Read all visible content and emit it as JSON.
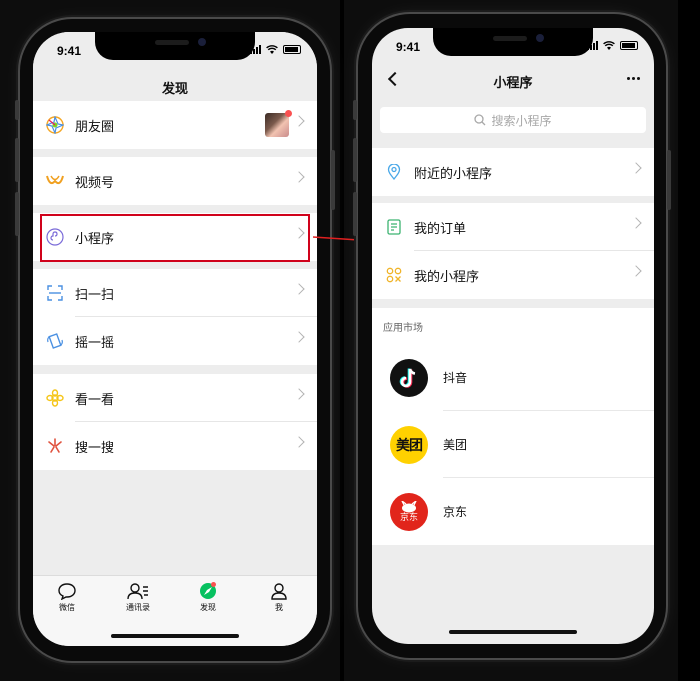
{
  "left_phone": {
    "status_time": "9:41",
    "title": "发现",
    "groups": [
      [
        {
          "label": "朋友圈",
          "icon": "moments-icon",
          "has_avatar": true
        }
      ],
      [
        {
          "label": "视频号",
          "icon": "channels-icon"
        }
      ],
      [
        {
          "label": "小程序",
          "icon": "mini-program-icon",
          "highlighted": true
        }
      ],
      [
        {
          "label": "扫一扫",
          "icon": "scan-icon"
        },
        {
          "label": "摇一摇",
          "icon": "shake-icon"
        }
      ],
      [
        {
          "label": "看一看",
          "icon": "top-stories-icon"
        },
        {
          "label": "搜一搜",
          "icon": "search-icon"
        }
      ]
    ],
    "tabs": [
      {
        "label": "微信",
        "icon": "chat-icon"
      },
      {
        "label": "通讯录",
        "icon": "contacts-icon"
      },
      {
        "label": "发现",
        "icon": "discover-icon",
        "badge": true
      },
      {
        "label": "我",
        "icon": "me-icon"
      }
    ]
  },
  "right_phone": {
    "status_time": "9:41",
    "title": "小程序",
    "search_placeholder": "搜索小程序",
    "groups": [
      [
        {
          "label": "附近的小程序",
          "icon": "location-icon"
        }
      ],
      [
        {
          "label": "我的订单",
          "icon": "order-icon"
        },
        {
          "label": "我的小程序",
          "icon": "my-mini-programs-icon"
        }
      ]
    ],
    "section_label": "应用市场",
    "apps": [
      {
        "name": "抖音",
        "icon": "douyin-logo"
      },
      {
        "name": "美团",
        "icon": "meituan-logo",
        "logo_text": "美团"
      },
      {
        "name": "京东",
        "icon": "jd-logo",
        "logo_text": "京东"
      }
    ]
  },
  "colors": {
    "highlight_border": "#d0021b",
    "arrow": "#e02020",
    "badge": "#fa5151",
    "page_bg": "#ededed",
    "wechat_green": "#07c160",
    "meituan_yellow": "#ffd100",
    "jd_red": "#e1251b"
  }
}
